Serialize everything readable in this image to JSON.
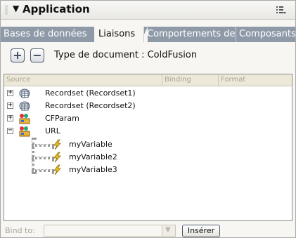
{
  "panel": {
    "title": "Application",
    "collapse_arrow": "▼",
    "options_icon": "panel-options-icon"
  },
  "tabs": [
    {
      "label": "Bases de données",
      "active": false
    },
    {
      "label": "Liaisons",
      "active": true
    },
    {
      "label": "Comportements de",
      "active": false
    },
    {
      "label": "Composants",
      "active": false
    }
  ],
  "toolbar": {
    "add_glyph": "+",
    "remove_glyph": "−",
    "doc_type_label": "Type de document : ColdFusion"
  },
  "table": {
    "columns": [
      "Source",
      "Binding",
      "Format"
    ],
    "rows": [
      {
        "label": "Recordset (Recordset1)",
        "expander": "+",
        "icon": "recordset-icon"
      },
      {
        "label": "Recordset (Recordset2)",
        "expander": "+",
        "icon": "recordset-icon"
      },
      {
        "label": "CFParam",
        "expander": "+",
        "icon": "cfparam-icon"
      },
      {
        "label": "URL",
        "expander": "−",
        "icon": "url-icon",
        "children": [
          {
            "label": "myVariable",
            "icon": "lightning-bolt-icon"
          },
          {
            "label": "myVariable2",
            "icon": "lightning-bolt-icon"
          },
          {
            "label": "myVariable3",
            "icon": "lightning-bolt-icon"
          }
        ]
      }
    ]
  },
  "footer": {
    "bind_label": "Bind to:",
    "bind_value": "",
    "insert_label": "Insérer"
  },
  "colors": {
    "tab_bar": "#8f9aa9",
    "panel_bg": "#f7f6f2",
    "header_bg": "#ece9d8"
  }
}
